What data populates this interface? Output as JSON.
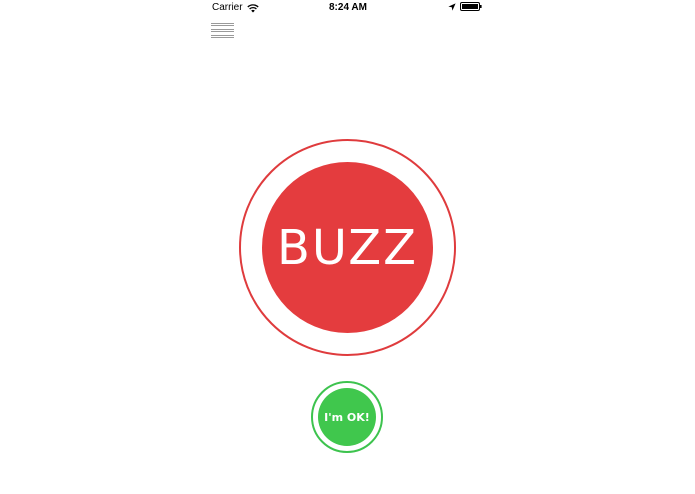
{
  "status_bar": {
    "carrier": "Carrier",
    "time": "8:24 AM",
    "wifi_icon": "wifi-icon",
    "location_icon": "location-arrow-icon",
    "battery_icon": "battery-icon"
  },
  "header": {
    "menu_icon": "hamburger-menu-icon"
  },
  "main": {
    "buzz_label": "BUZZ",
    "ok_label": "I'm OK!"
  },
  "colors": {
    "buzz_red": "#e43c3e",
    "ok_green": "#40c74d",
    "background": "#ffffff"
  }
}
